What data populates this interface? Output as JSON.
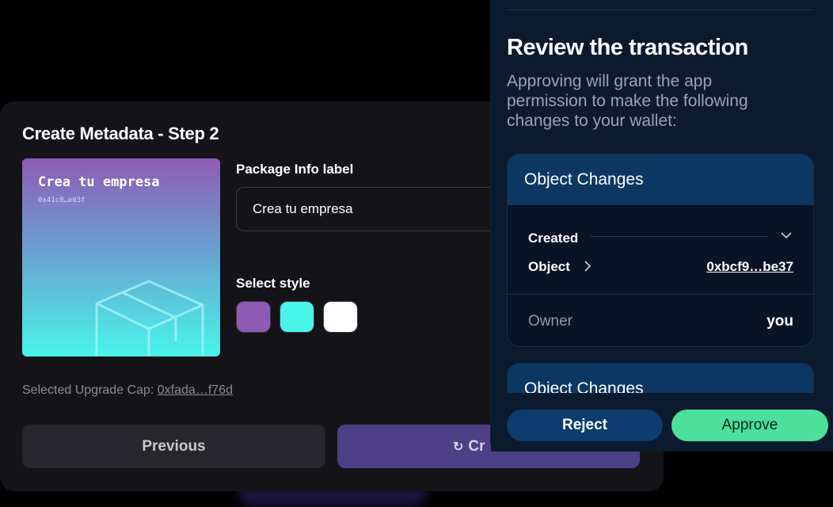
{
  "metadata_form": {
    "title": "Create Metadata - Step 2",
    "preview": {
      "name": "Crea tu empresa",
      "id": "0x41c0…e03f",
      "icon": "box-icon"
    },
    "package_info_label": "Package Info label",
    "package_info_value": "Crea tu empresa",
    "select_style_label": "Select style",
    "styles": [
      {
        "color": "#8e5bb5"
      },
      {
        "color": "#49f4ea"
      },
      {
        "color": "#ffffff"
      }
    ],
    "upgrade_cap_label": "Selected Upgrade Cap: ",
    "upgrade_cap_value": "0xfada…f76d",
    "previous_button": "Previous",
    "create_button": "Cr"
  },
  "wallet": {
    "title": "Review the transaction",
    "description": "Approving will grant the app permission to make the following changes to your wallet:",
    "object_changes": [
      {
        "header": "Object Changes",
        "change_type": "Created",
        "object_label": "Object",
        "object_id": "0xbcf9…be37",
        "owner_label": "Owner",
        "owner_value": "you"
      },
      {
        "header": "Object Changes"
      }
    ],
    "reject_button": "Reject",
    "approve_button": "Approve"
  },
  "colors": {
    "accent_purple": "#4c3f86",
    "approve_green": "#4ce09a",
    "wallet_blue": "#0c3762"
  }
}
